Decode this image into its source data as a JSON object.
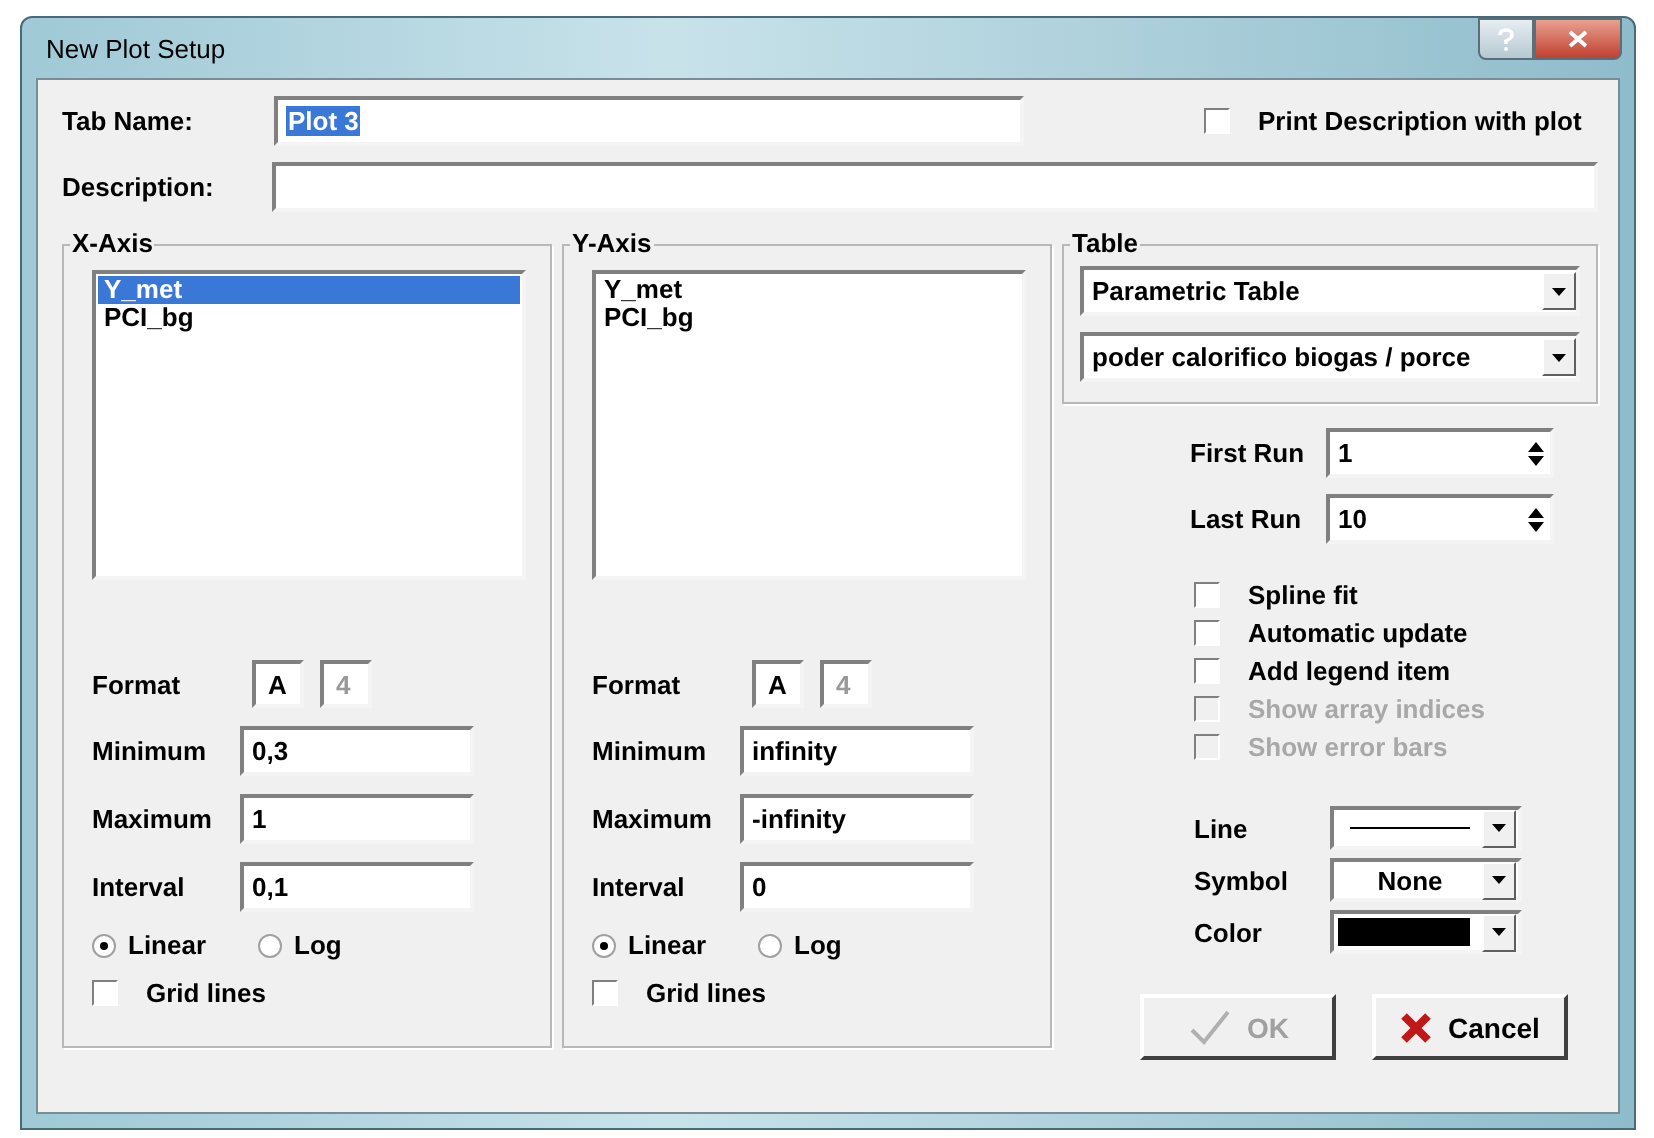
{
  "window": {
    "title": "New Plot Setup"
  },
  "tab_name": {
    "label": "Tab Name:",
    "value": "Plot 3",
    "text_selected": true
  },
  "print_description": {
    "label": "Print Description with plot",
    "checked": false
  },
  "description": {
    "label": "Description:"
  },
  "axes": [
    {
      "title": "X-Axis",
      "variables": [
        {
          "name": "Y_met",
          "selected": true
        },
        {
          "name": "PCI_bg",
          "selected": false
        }
      ],
      "format": {
        "label": "Format",
        "boxes": [
          {
            "value": "A",
            "disabled": false
          },
          {
            "value": "4",
            "disabled": true
          }
        ]
      },
      "fields": [
        {
          "label": "Minimum",
          "value": "0,3"
        },
        {
          "label": "Maximum",
          "value": "1"
        },
        {
          "label": "Interval",
          "value": "0,1"
        }
      ],
      "scale": [
        {
          "label": "Linear",
          "selected": true
        },
        {
          "label": "Log",
          "selected": false
        }
      ],
      "grid_lines": {
        "label": "Grid lines",
        "checked": false
      }
    },
    {
      "title": "Y-Axis",
      "variables": [
        {
          "name": "Y_met",
          "selected": false
        },
        {
          "name": "PCI_bg",
          "selected": false
        }
      ],
      "format": {
        "label": "Format",
        "boxes": [
          {
            "value": "A",
            "disabled": false
          },
          {
            "value": "4",
            "disabled": true
          }
        ]
      },
      "fields": [
        {
          "label": "Minimum",
          "value": "infinity"
        },
        {
          "label": "Maximum",
          "value": "-infinity"
        },
        {
          "label": "Interval",
          "value": "0"
        }
      ],
      "scale": [
        {
          "label": "Linear",
          "selected": true
        },
        {
          "label": "Log",
          "selected": false
        }
      ],
      "grid_lines": {
        "label": "Grid lines",
        "checked": false
      }
    }
  ],
  "table": {
    "title": "Table",
    "dropdowns": [
      {
        "value": "Parametric Table"
      },
      {
        "value": "poder calorifico biogas / porce"
      }
    ]
  },
  "runs": [
    {
      "label": "First Run",
      "value": "1"
    },
    {
      "label": "Last Run",
      "value": "10"
    }
  ],
  "options": [
    {
      "label": "Spline fit",
      "checked": false,
      "disabled": false
    },
    {
      "label": "Automatic update",
      "checked": false,
      "disabled": false
    },
    {
      "label": "Add legend item",
      "checked": false,
      "disabled": false
    },
    {
      "label": "Show array indices",
      "checked": false,
      "disabled": true
    },
    {
      "label": "Show error bars",
      "checked": false,
      "disabled": true
    }
  ],
  "style": [
    {
      "label": "Line",
      "kind": "line"
    },
    {
      "label": "Symbol",
      "kind": "text",
      "value": "None"
    },
    {
      "label": "Color",
      "kind": "color",
      "color": "#000000"
    }
  ],
  "buttons": [
    {
      "label": "OK",
      "kind": "ok",
      "disabled": true
    },
    {
      "label": "Cancel",
      "kind": "cancel",
      "disabled": false
    }
  ]
}
